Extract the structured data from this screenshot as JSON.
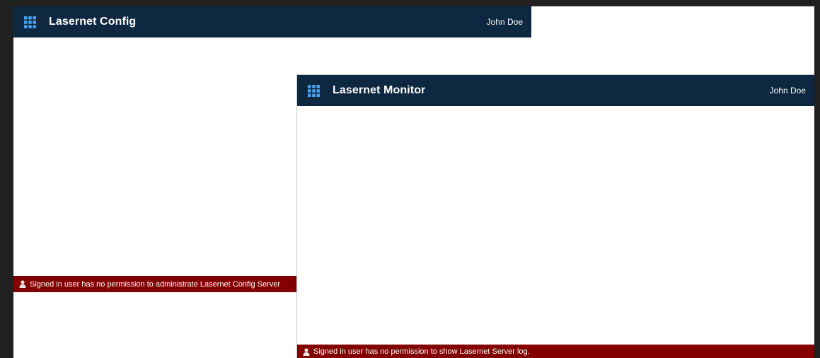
{
  "config_window": {
    "title": "Lasernet Config",
    "user": "John Doe",
    "error_message": "Signed in user has no permission to administrate Lasernet Config Server",
    "icons": {
      "launcher": "app-launcher-icon",
      "error": "person-icon"
    }
  },
  "monitor_window": {
    "title": "Lasernet Monitor",
    "user": "John Doe",
    "error_message": "Signed in user has no permission to show Lasernet Server log.",
    "icons": {
      "launcher": "app-launcher-icon",
      "error": "person-icon"
    }
  },
  "colors": {
    "header_bg": "#0e2841",
    "launcher_icon": "#4aa3f0",
    "error_bg": "#820000",
    "backdrop": "#202020"
  }
}
